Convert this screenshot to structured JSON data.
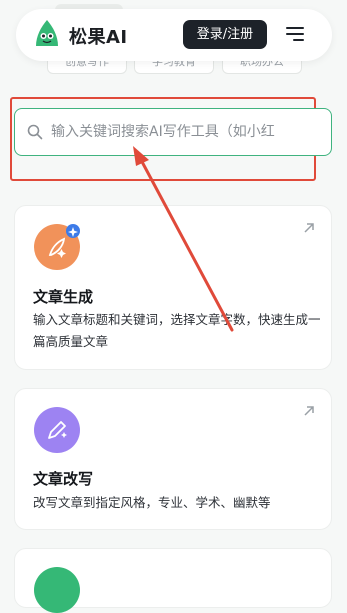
{
  "header": {
    "brand": "松果AI",
    "login_label": "登录/注册"
  },
  "behind_tabs": [
    "创意写作",
    "学习教育",
    "职场办公"
  ],
  "search": {
    "placeholder": "输入关键词搜索AI写作工具（如小红"
  },
  "cards": [
    {
      "title": "文章生成",
      "description": "输入文章标题和关键词，选择文章字数，快速生成一篇高质量文章",
      "icon": "pen-nib-icon",
      "icon_color": "#f1925a"
    },
    {
      "title": "文章改写",
      "description": "改写文章到指定风格，专业、学术、幽默等",
      "icon": "pencil-sparkle-icon",
      "icon_color": "#9d83f2"
    }
  ],
  "colors": {
    "accent_green": "#3fb37f",
    "annotation_red": "#e04a3a",
    "login_bg": "#1d2229"
  }
}
